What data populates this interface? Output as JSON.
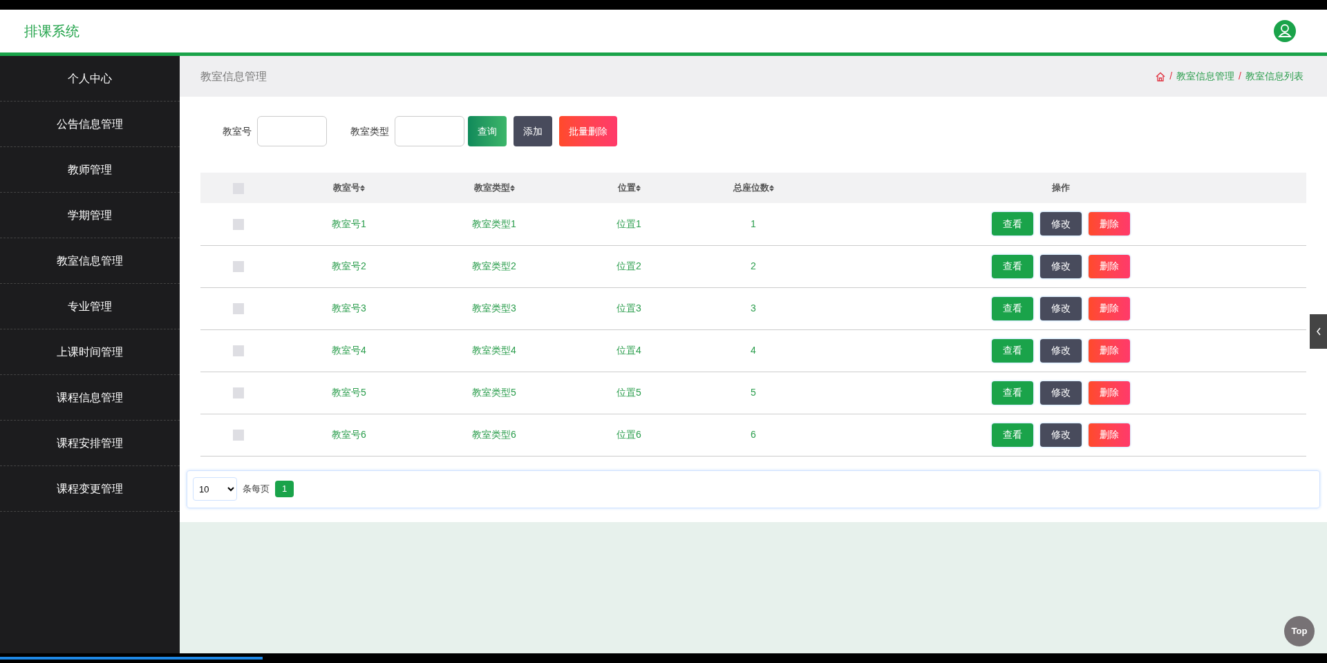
{
  "header": {
    "title": "排课系统"
  },
  "sidebar": {
    "items": [
      {
        "label": "个人中心",
        "selected": false
      },
      {
        "label": "公告信息管理",
        "selected": false
      },
      {
        "label": "教师管理",
        "selected": false
      },
      {
        "label": "学期管理",
        "selected": false
      },
      {
        "label": "教室信息管理",
        "selected": false
      },
      {
        "label": "专业管理",
        "selected": false
      },
      {
        "label": "上课时间管理",
        "selected": false
      },
      {
        "label": "课程信息管理",
        "selected": false
      },
      {
        "label": "课程安排管理",
        "selected": false
      },
      {
        "label": "课程变更管理",
        "selected": false
      }
    ]
  },
  "page_title": "教室信息管理",
  "breadcrumb": [
    "教室信息管理",
    "教室信息列表"
  ],
  "breadcrumb_separator": "/",
  "search": {
    "fields": [
      {
        "label": "教室号"
      },
      {
        "label": "教室类型"
      }
    ],
    "buttons": [
      {
        "label": "查询",
        "kind": "query"
      },
      {
        "label": "添加",
        "kind": "add"
      },
      {
        "label": "批量删除",
        "kind": "delete"
      }
    ]
  },
  "table": {
    "columns": [
      {
        "label": "教室号",
        "sortable": true
      },
      {
        "label": "教室类型",
        "sortable": true
      },
      {
        "label": "位置",
        "sortable": true
      },
      {
        "label": "总座位数",
        "sortable": true
      },
      {
        "label": "操作"
      }
    ],
    "header_checked": false,
    "rows": [
      {
        "checked": false,
        "cells": [
          "教室号1",
          "教室类型1",
          "位置1",
          "1"
        ],
        "actions": [
          "查看",
          "修改",
          "删除"
        ]
      },
      {
        "checked": false,
        "cells": [
          "教室号2",
          "教室类型2",
          "位置2",
          "2"
        ],
        "actions": [
          "查看",
          "修改",
          "删除"
        ]
      },
      {
        "checked": false,
        "cells": [
          "教室号3",
          "教室类型3",
          "位置3",
          "3"
        ],
        "actions": [
          "查看",
          "修改",
          "删除"
        ]
      },
      {
        "checked": false,
        "cells": [
          "教室号4",
          "教室类型4",
          "位置4",
          "4"
        ],
        "actions": [
          "查看",
          "修改",
          "删除"
        ]
      },
      {
        "checked": false,
        "cells": [
          "教室号5",
          "教室类型5",
          "位置5",
          "5"
        ],
        "actions": [
          "查看",
          "修改",
          "删除"
        ]
      },
      {
        "checked": false,
        "cells": [
          "教室号6",
          "教室类型6",
          "位置6",
          "6"
        ],
        "actions": [
          "查看",
          "修改",
          "删除"
        ]
      }
    ]
  },
  "pagination": {
    "page_size": "10",
    "per_page_label": "条每页",
    "pages": [
      {
        "label": "1",
        "selected": true
      }
    ]
  },
  "top_button": "Top",
  "progress": {
    "level": 0.198
  }
}
